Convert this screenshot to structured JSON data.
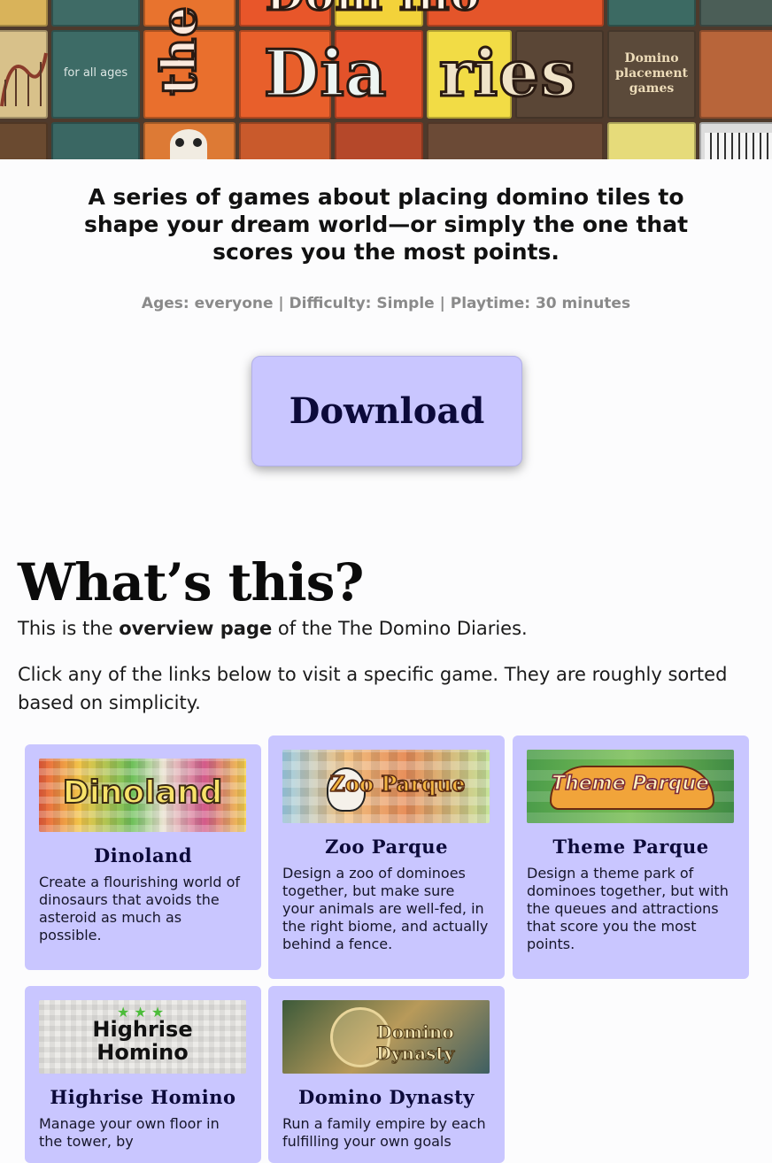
{
  "hero": {
    "title_top_left": "the",
    "title_top_right": "Dom  ino",
    "title_part1": "Dia",
    "title_part2": "ries",
    "left_badge": "for all ages",
    "right_badge": "Domino placement games"
  },
  "tagline": "A series of games about placing domino tiles to shape your dream world—or simply the one that scores you the most points.",
  "meta": "Ages: everyone | Difficulty: Simple | Playtime: 30 minutes",
  "download_label": "Download",
  "section_title": "What’s this?",
  "intro": {
    "pre": "This is the ",
    "bold": "overview page",
    "post": " of the The Domino Diaries.",
    "second": "Click any of the links below to visit a specific game. They are roughly sorted based on simplicity."
  },
  "cards": [
    {
      "title": "Dinoland",
      "thumb_text": "Dinoland",
      "description": "Create a flourishing world of dinosaurs that avoids the asteroid as much as possible."
    },
    {
      "title": "Zoo Parque",
      "thumb_text": "Zoo Parque",
      "description": "Design a zoo of dominoes together, but make sure your animals are well-fed, in the right biome, and actually behind a fence."
    },
    {
      "title": "Theme Parque",
      "thumb_text": "Theme Parque",
      "description": "Design a theme park of dominoes together, but with the queues and attractions that score you the most points."
    },
    {
      "title": "Highrise Homino",
      "thumb_text": "Highrise Homino",
      "description": "Manage your own floor in the tower, by"
    },
    {
      "title": "Domino Dynasty",
      "thumb_text": "Domino Dynasty",
      "description": "Run a family empire by each fulfilling your own goals"
    }
  ],
  "colors": {
    "card_bg": "#c9c6ff",
    "title_ink": "#0c0a3a",
    "meta_gray": "#8a8a8a"
  }
}
